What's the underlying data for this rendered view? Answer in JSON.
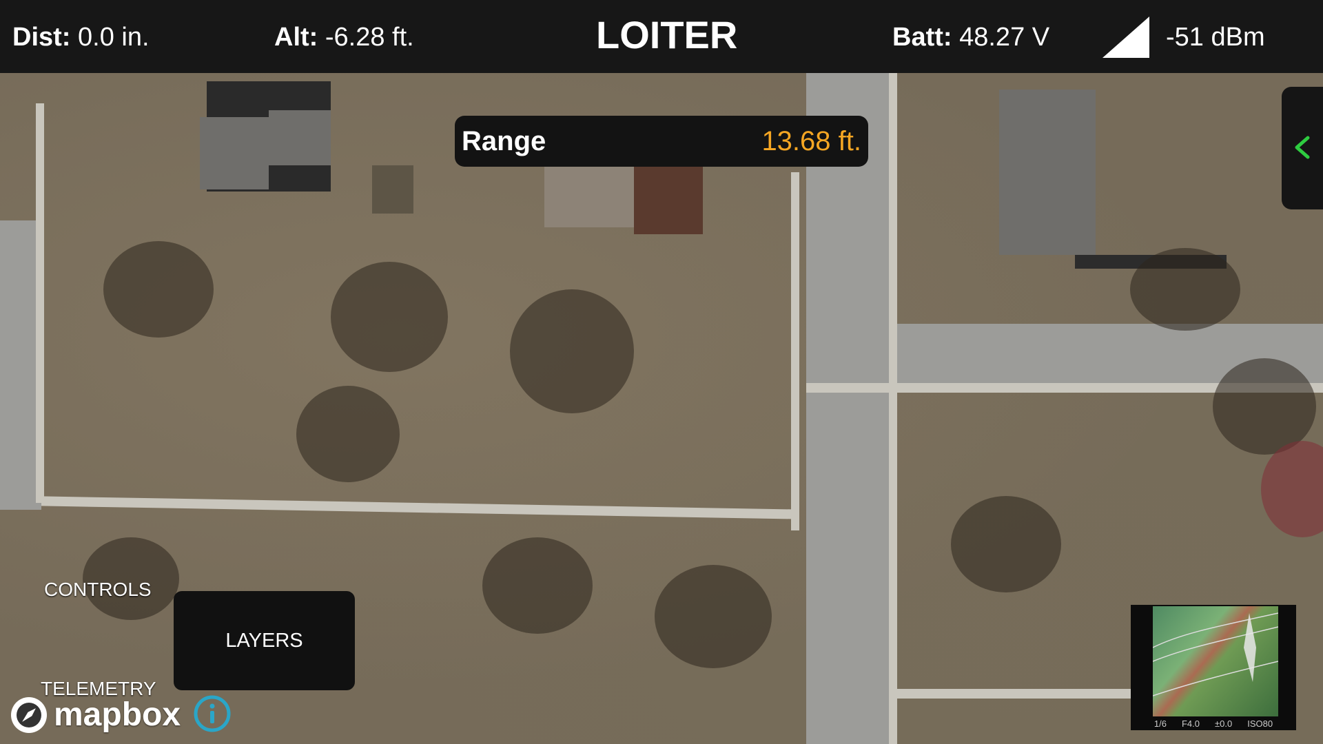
{
  "header": {
    "dist_label": "Dist:",
    "dist_value": "0.0 in.",
    "alt_label": "Alt:",
    "alt_value": "-6.28 ft.",
    "flight_mode": "LOITER",
    "batt_label": "Batt:",
    "batt_value": "48.27 V",
    "signal_icon": "signal-strength-icon",
    "signal_value": "-51 dBm"
  },
  "range": {
    "label": "Range",
    "value": "13.68 ft.",
    "value_color": "#f5a623"
  },
  "drawer": {
    "icon": "chevron-left-icon",
    "accent": "#2ecc40"
  },
  "controls": {
    "controls_label": "CONTROLS",
    "layers_button": "LAYERS",
    "telemetry_label": "TELEMETRY"
  },
  "map": {
    "provider": "mapbox",
    "info_icon": "info-icon",
    "info_color": "#2aa6c8"
  },
  "camera": {
    "shutter": "1/6",
    "aperture": "F4.0",
    "exposure": "±0.0",
    "iso": "ISO80"
  }
}
